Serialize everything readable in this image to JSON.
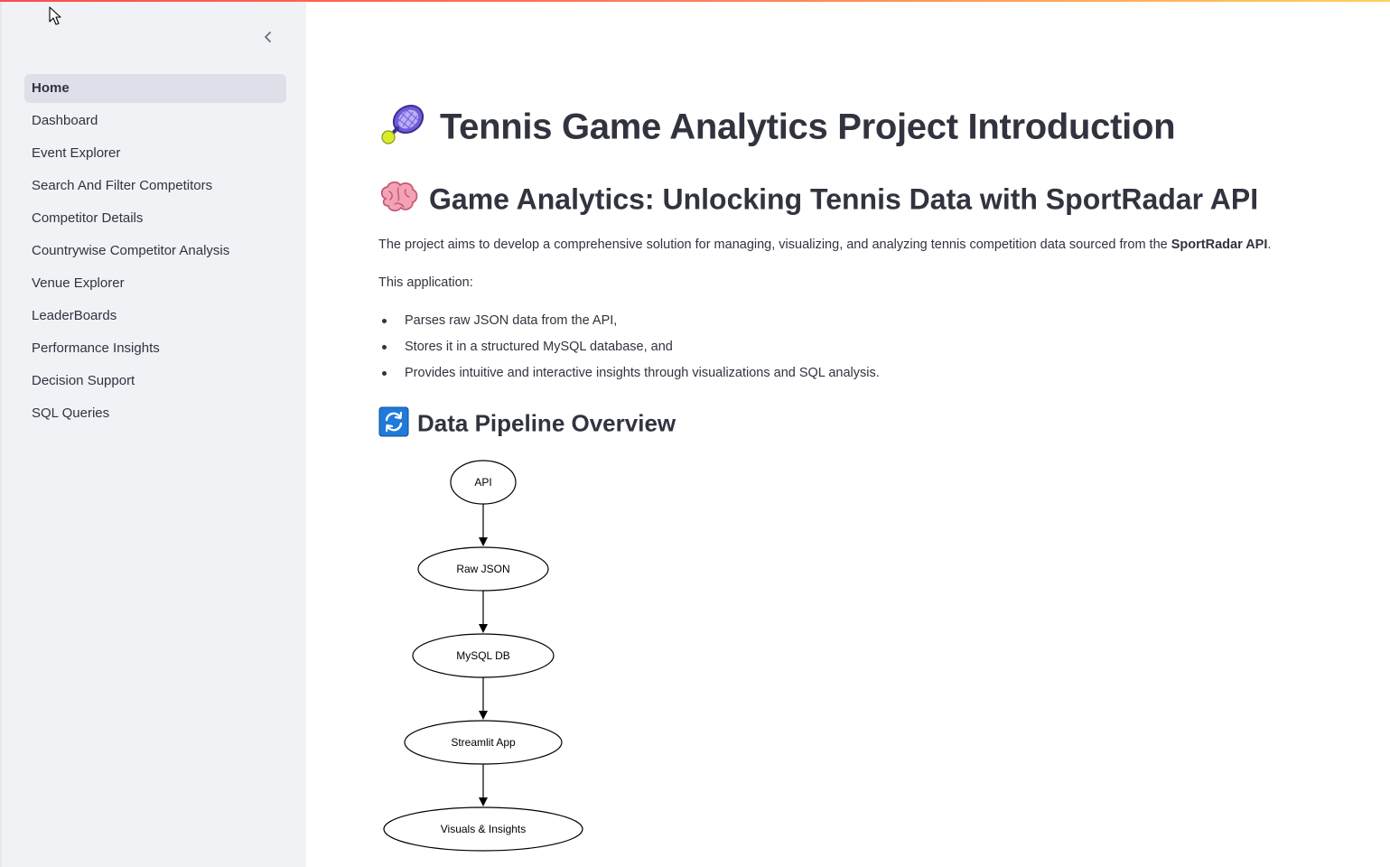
{
  "sidebar": {
    "collapse_icon": "chevron-left-icon",
    "items": [
      {
        "label": "Home",
        "active": true
      },
      {
        "label": "Dashboard"
      },
      {
        "label": "Event Explorer"
      },
      {
        "label": "Search And Filter Competitors"
      },
      {
        "label": "Competitor Details"
      },
      {
        "label": "Countrywise Competitor Analysis"
      },
      {
        "label": "Venue Explorer"
      },
      {
        "label": "LeaderBoards"
      },
      {
        "label": "Performance Insights"
      },
      {
        "label": "Decision Support"
      },
      {
        "label": "SQL Queries"
      }
    ]
  },
  "main": {
    "title": "Tennis Game Analytics Project Introduction",
    "title_icon": "tennis-racket-icon",
    "subtitle": "Game Analytics: Unlocking Tennis Data with SportRadar API",
    "subtitle_icon": "brain-icon",
    "intro_text": "The project aims to develop a comprehensive solution for managing, visualizing, and analyzing tennis competition data sourced from the ",
    "intro_bold": "SportRadar API",
    "intro_end": ".",
    "app_label": "This application:",
    "bullets": [
      "Parses raw JSON data from the API,",
      "Stores it in a structured MySQL database, and",
      "Provides intuitive and interactive insights through visualizations and SQL analysis."
    ],
    "pipeline_heading": "Data Pipeline Overview",
    "pipeline_icon": "refresh-icon"
  },
  "diagram": {
    "nodes": [
      "API",
      "Raw JSON",
      "MySQL DB",
      "Streamlit App",
      "Visuals & Insights"
    ]
  },
  "colors": {
    "accent_gradient_start": "#ff4b4b",
    "accent_gradient_end": "#ffd25a",
    "sidebar_bg": "#f0f2f6",
    "active_item_bg": "#dde0e8",
    "text": "#31333f"
  }
}
